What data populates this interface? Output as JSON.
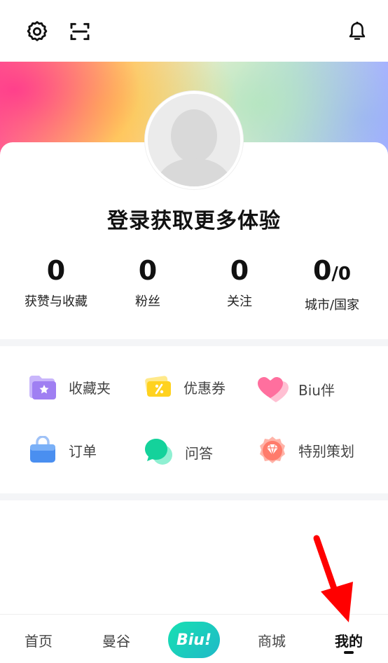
{
  "topbar": {
    "settings_icon": "gear-icon",
    "scan_icon": "scan-icon",
    "notification_icon": "bell-icon"
  },
  "profile": {
    "login_prompt": "登录获取更多体验",
    "stats": [
      {
        "value": "0",
        "label": "获赞与收藏"
      },
      {
        "value": "0",
        "label": "粉丝"
      },
      {
        "value": "0",
        "label": "关注"
      },
      {
        "value": "0",
        "value_suffix": "/0",
        "label": "城市/国家"
      }
    ]
  },
  "menu": {
    "items": [
      {
        "label": "收藏夹",
        "icon": "folder-star-icon",
        "color": "#a98bf5"
      },
      {
        "label": "优惠券",
        "icon": "coupon-icon",
        "color": "#ffd43b"
      },
      {
        "label": "Biu伴",
        "icon": "hearts-icon",
        "color": "#ff7aa8"
      },
      {
        "label": "订单",
        "icon": "bag-icon",
        "color": "#4a8ff0"
      },
      {
        "label": "问答",
        "icon": "chat-bubble-icon",
        "color": "#1fd6a4"
      },
      {
        "label": "特别策划",
        "icon": "gem-badge-icon",
        "color": "#ff7b6b"
      }
    ]
  },
  "bottom_nav": {
    "items": [
      {
        "label": "首页"
      },
      {
        "label": "曼谷"
      },
      {
        "label": "Biu!"
      },
      {
        "label": "商城"
      },
      {
        "label": "我的"
      }
    ],
    "active": "我的"
  },
  "colors": {
    "accent": "#1fd6b0",
    "annotation_arrow": "#ff0000"
  }
}
